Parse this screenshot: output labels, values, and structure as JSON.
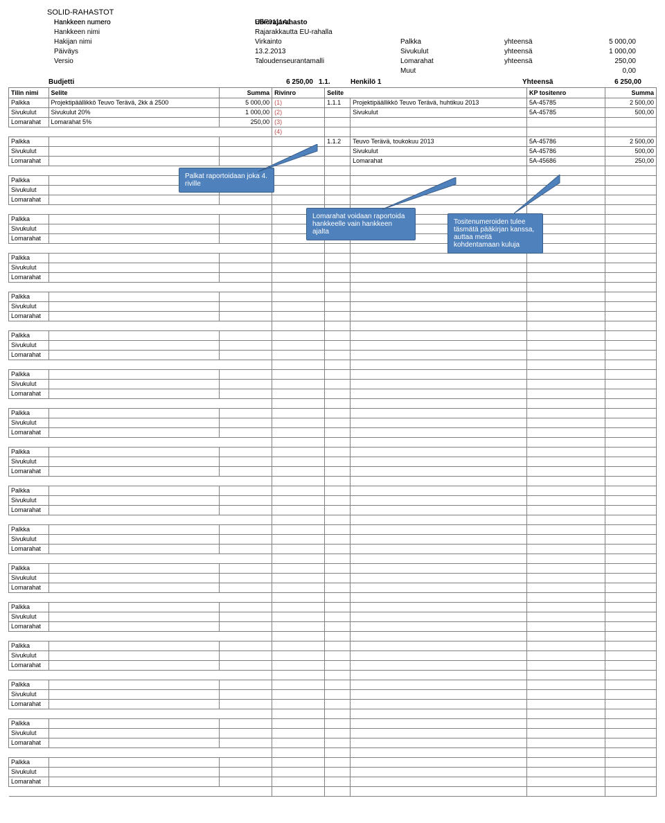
{
  "title": "SOLID-RAHASTOT",
  "fund_label": "Ulkorajarahasto",
  "meta": {
    "rows": [
      {
        "label": "Hankkeen numero",
        "mid": "EBF0111A1"
      },
      {
        "label": "Hankkeen nimi",
        "mid": "Rajarakkautta EU-rahalla"
      },
      {
        "label": "Hakijan nimi",
        "mid": "Virkainto",
        "slabel": "Palkka",
        "ylabel": "yhteensä",
        "val": "5 000,00"
      },
      {
        "label": "Päiväys",
        "mid": "13.2.2013",
        "slabel": "Sivukulut",
        "ylabel": "yhteensä",
        "val": "1 000,00"
      },
      {
        "label": "Versio",
        "mid": "Taloudenseurantamalli",
        "slabel": "Lomarahat",
        "ylabel": "yhteensä",
        "val": "250,00"
      },
      {
        "label": "",
        "mid": "",
        "slabel": "Muut",
        "ylabel": "",
        "val": "0,00"
      }
    ]
  },
  "budget_header": {
    "left_label": "Budjetti",
    "left_amount": "6 250,00",
    "right1": "1.1.",
    "right2": "Henkilö 1",
    "right3": "Yhteensä",
    "right_amount": "6 250,00"
  },
  "columns": {
    "c1": "Tilin nimi",
    "c2": "Selite",
    "c3": "Summa",
    "c4": "Rivinro",
    "c5": "Selite",
    "c6": "KP tositenro",
    "c7": "Summa"
  },
  "row1": {
    "palkka": {
      "a": "Palkka",
      "b": "Projektipäällikkö Teuvo Terävä, 2kk á 2500",
      "c": "5 000,00",
      "d": "(1)",
      "e": "1.1.1",
      "f": "Projektipäällikkö Teuvo Terävä, huhtikuu 2013",
      "g": "5A-45785",
      "h": "2 500,00"
    },
    "sivu": {
      "a": "Sivukulut",
      "b": "Sivukulut 20%",
      "c": "1 000,00",
      "d": "(2)",
      "e": "",
      "f": "Sivukulut",
      "g": "5A-45785",
      "h": "500,00"
    },
    "loma": {
      "a": "Lomarahat",
      "b": "Lomarahat 5%",
      "c": "250,00",
      "d": "(3)"
    },
    "r4": {
      "d": "(4)"
    }
  },
  "row2": {
    "palkka": {
      "a": "Palkka",
      "e": "1.1.2",
      "f": "Teuvo Terävä, toukokuu 2013",
      "g": "5A-45786",
      "h": "2 500,00"
    },
    "sivu": {
      "a": "Sivukulut",
      "f": "Sivukulut",
      "g": "5A-45786",
      "h": "500,00"
    },
    "loma": {
      "a": "Lomarahat",
      "f": "Lomarahat",
      "g": "5A-45686",
      "h": "250,00"
    }
  },
  "labels": {
    "palkka": "Palkka",
    "sivukulut": "Sivukulut",
    "lomarahat": "Lomarahat"
  },
  "callouts": {
    "c1": "Palkat raportoidaan joka 4. riville",
    "c2": "Lomarahat voidaan raportoida hankkeelle vain hankkeen ajalta",
    "c3": "Tositenumeroiden tulee täsmätä pääkirjan kanssa, auttaa meitä kohdentamaan kuluja"
  }
}
